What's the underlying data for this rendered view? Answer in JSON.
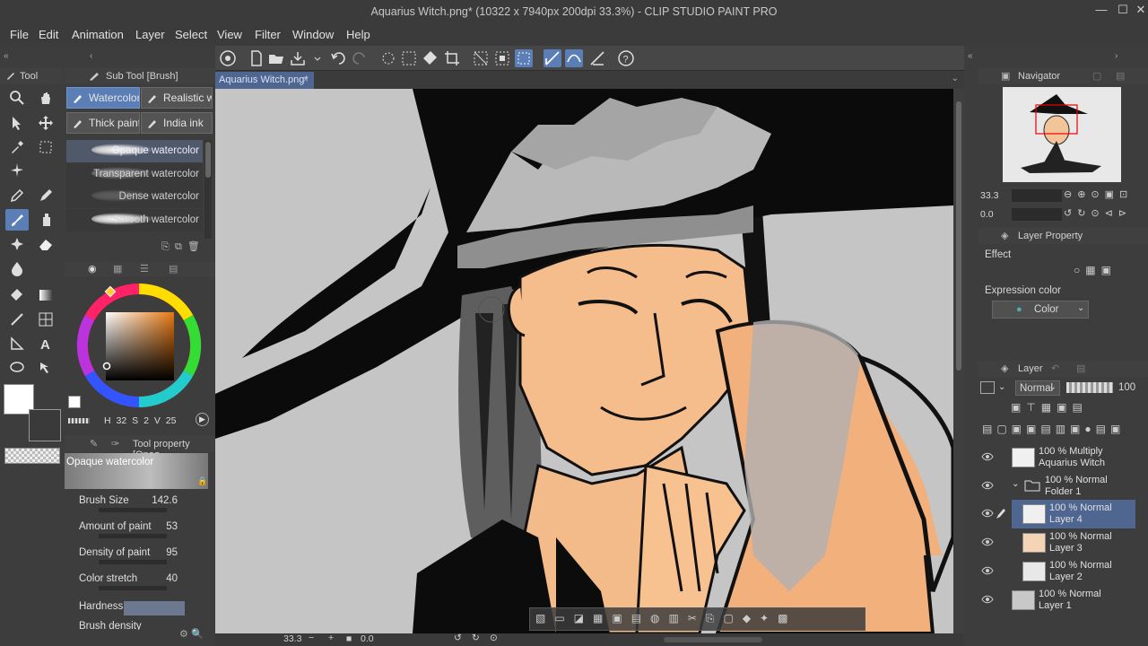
{
  "window": {
    "title": "Aquarius Witch.png* (10322 x 7940px 200dpi 33.3%) - CLIP STUDIO PAINT PRO"
  },
  "menu": [
    "File",
    "Edit",
    "Animation",
    "Layer",
    "Select",
    "View",
    "Filter",
    "Window",
    "Help"
  ],
  "document_tab": {
    "label": "Aquarius Witch.png*",
    "close": "×"
  },
  "tool_panel": {
    "label": "Tool"
  },
  "subtool_panel": {
    "title": "Sub Tool [Brush]",
    "tabs": [
      "Watercolor",
      "Realistic wa",
      "Thick paint",
      "India ink"
    ],
    "brushes": [
      "Opaque watercolor",
      "Transparent watercolor",
      "Dense watercolor",
      "Smooth watercolor"
    ]
  },
  "color_panel": {
    "main_color": "#ffffff",
    "sub_color": "#3a3a3a",
    "readout": [
      "H",
      "32",
      "S",
      "2",
      "V",
      "25"
    ]
  },
  "tool_property": {
    "title": "Tool property [Opaq",
    "brush_name": "Opaque watercolor",
    "rows": [
      {
        "label": "Brush Size",
        "value": "142.6"
      },
      {
        "label": "Amount of paint",
        "value": "53"
      },
      {
        "label": "Density of paint",
        "value": "95"
      },
      {
        "label": "Color stretch",
        "value": "40"
      },
      {
        "label": "Hardness",
        "value": ""
      },
      {
        "label": "Brush density",
        "value": ""
      }
    ]
  },
  "status": {
    "zoom": "33.3",
    "rotation": "0.0"
  },
  "navigator": {
    "title": "Navigator",
    "zoom": "33.3",
    "rotation": "0.0"
  },
  "layer_property": {
    "title": "Layer Property",
    "effect_label": "Effect",
    "expression_label": "Expression color",
    "expression_value": "Color"
  },
  "layer_panel": {
    "title": "Layer",
    "blend_mode": "Normal",
    "opacity": "100",
    "layers": [
      {
        "line1": "100 % Multiply",
        "line2": "Aquarius Witch",
        "active": false
      },
      {
        "line1": "100 % Normal",
        "line2": "Folder 1",
        "active": false
      },
      {
        "line1": "100 % Normal",
        "line2": "Layer 4",
        "active": true
      },
      {
        "line1": "100 % Normal",
        "line2": "Layer 3",
        "active": false
      },
      {
        "line1": "100 % Normal",
        "line2": "Layer 2",
        "active": false
      },
      {
        "line1": "100 % Normal",
        "line2": "Layer 1",
        "active": false
      }
    ]
  }
}
